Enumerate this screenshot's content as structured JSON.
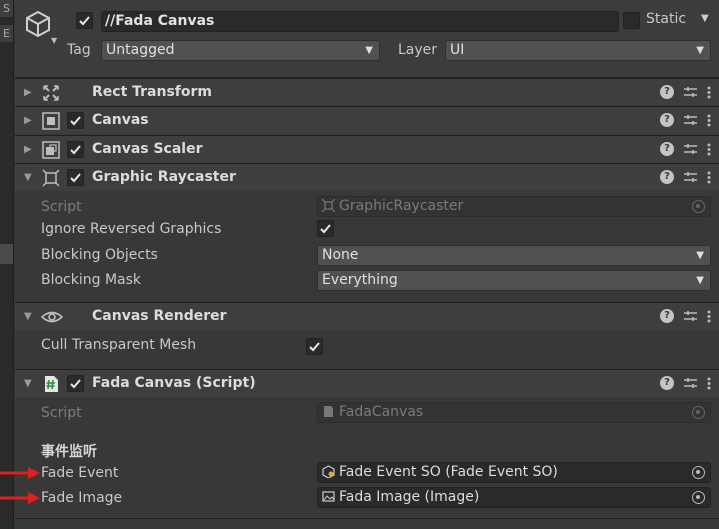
{
  "header": {
    "object_name": "//Fada Canvas",
    "static_label": "Static",
    "tag_label": "Tag",
    "tag_value": "Untagged",
    "layer_label": "Layer",
    "layer_value": "UI"
  },
  "components": [
    {
      "title": "Rect Transform",
      "icon": "rect-transform-icon",
      "has_checkbox": false
    },
    {
      "title": "Canvas",
      "icon": "canvas-icon",
      "has_checkbox": true
    },
    {
      "title": "Canvas Scaler",
      "icon": "canvas-scaler-icon",
      "has_checkbox": true
    },
    {
      "title": "Graphic Raycaster",
      "icon": "graphic-raycaster-icon",
      "has_checkbox": true
    },
    {
      "title": "Canvas Renderer",
      "icon": "eye-icon",
      "has_checkbox": false
    },
    {
      "title": "Fada Canvas (Script)",
      "icon": "script-icon",
      "has_checkbox": true
    }
  ],
  "graphic_raycaster": {
    "script_label": "Script",
    "script_value": "GraphicRaycaster",
    "ignore_reversed_label": "Ignore Reversed Graphics",
    "blocking_objects_label": "Blocking Objects",
    "blocking_objects_value": "None",
    "blocking_mask_label": "Blocking Mask",
    "blocking_mask_value": "Everything"
  },
  "canvas_renderer": {
    "cull_label": "Cull Transparent Mesh"
  },
  "fada_canvas": {
    "script_label": "Script",
    "script_value": "FadaCanvas",
    "section_header": "事件监听",
    "fade_event_label": "Fade Event",
    "fade_event_value": "Fade Event SO (Fade Event SO)",
    "fade_image_label": "Fade Image",
    "fade_image_value": "Fada Image (Image)"
  },
  "left_strip": {
    "top_glyph": "S",
    "second_glyph": "E"
  },
  "colors": {
    "panel_bg": "#383838",
    "header_bg": "#3e3e3e",
    "field_bg": "#2a2a2a",
    "dropdown_bg": "#515151",
    "annotation_red": "#e0201c"
  }
}
